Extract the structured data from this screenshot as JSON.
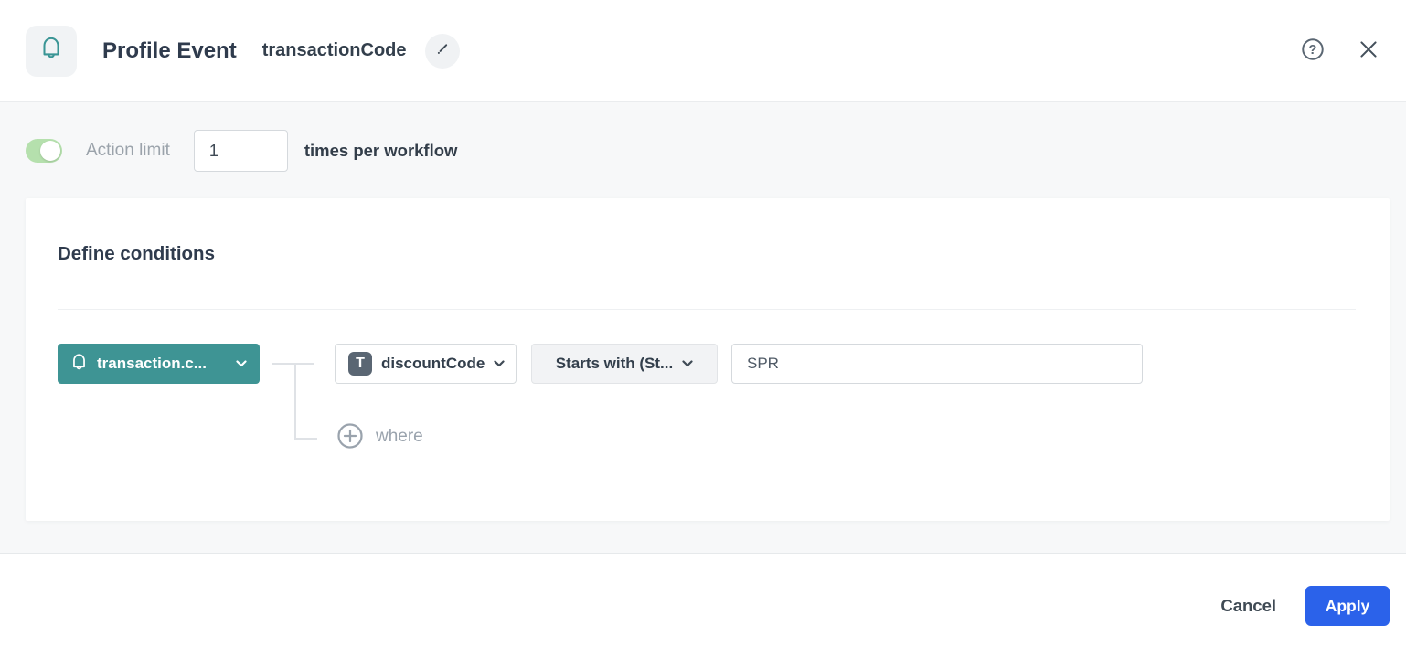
{
  "header": {
    "title": "Profile Event",
    "subtitle": "transactionCode"
  },
  "action_limit": {
    "enabled": true,
    "label": "Action limit",
    "value": "1",
    "suffix": "times per workflow"
  },
  "conditions": {
    "heading": "Define conditions",
    "event_selector": "transaction.c...",
    "rows": [
      {
        "attribute": "discountCode",
        "attribute_type_glyph": "T",
        "operator": "Starts with (St...",
        "value": "SPR"
      }
    ],
    "add_condition_label": "where"
  },
  "footer": {
    "cancel": "Cancel",
    "apply": "Apply"
  },
  "icons": {
    "event": "bell-icon",
    "edit": "pencil-icon",
    "help": "question-circle-icon",
    "close": "x-icon",
    "attribute_type": "text-type-icon",
    "dropdown": "chevron-down-icon",
    "add": "plus-circle-icon"
  },
  "colors": {
    "teal": "#3E9494",
    "apply_blue": "#2B62EA",
    "toggle_green": "#B5E0AD",
    "muted_text": "#9AA3AD",
    "dark_text": "#2F3B4D",
    "background_gray": "#F7F8F9"
  }
}
